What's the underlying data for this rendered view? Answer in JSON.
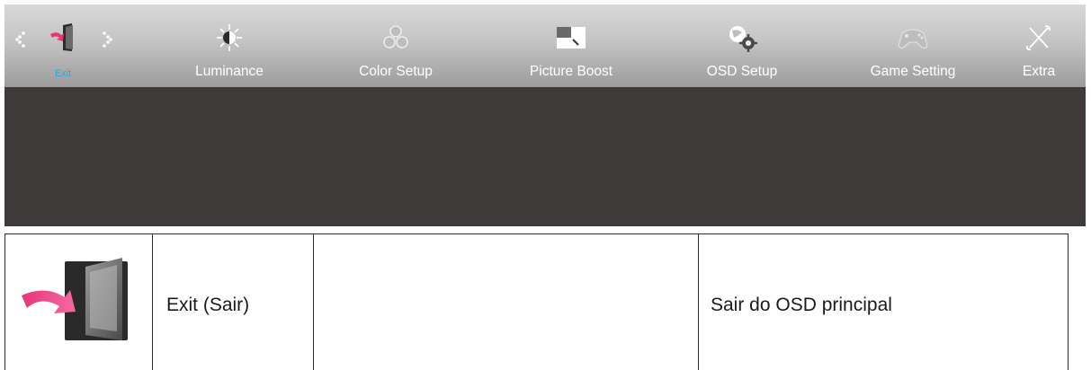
{
  "menu": {
    "items": [
      {
        "label": "Exit",
        "icon": "exit-icon",
        "active": true
      },
      {
        "label": "Luminance",
        "icon": "luminance-icon"
      },
      {
        "label": "Color Setup",
        "icon": "color-setup-icon"
      },
      {
        "label": "Picture Boost",
        "icon": "picture-boost-icon"
      },
      {
        "label": "OSD Setup",
        "icon": "osd-setup-icon"
      },
      {
        "label": "Game Setting",
        "icon": "game-setting-icon"
      },
      {
        "label": "Extra",
        "icon": "extra-icon"
      }
    ],
    "active_color": "#28a9e0",
    "panel_color": "#3e3a39"
  },
  "table": {
    "row": {
      "icon": "exit-door-icon",
      "name": "Exit (Sair)",
      "value": "",
      "description": "Sair do OSD principal"
    }
  }
}
